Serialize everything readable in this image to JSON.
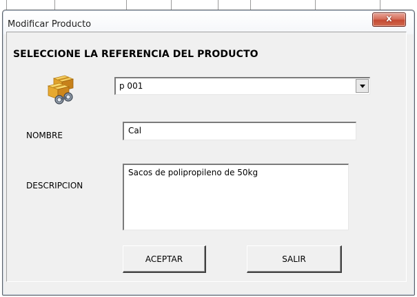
{
  "window": {
    "title": "Modificar Producto",
    "close_label": "x"
  },
  "form": {
    "heading": "SELECCIONE LA REFERENCIA DEL PRODUCTO",
    "product_icon": "boxes-binoculars-icon",
    "reference": {
      "value": "p 001",
      "dropdown_icon": "chevron-down-icon"
    },
    "nombre": {
      "label": "NOMBRE",
      "value": "Cal"
    },
    "descripcion": {
      "label": "DESCRIPCION",
      "value": "Sacos de polipropileno de 50kg"
    },
    "buttons": {
      "accept": "ACEPTAR",
      "exit": "SALIR"
    }
  },
  "colors": {
    "close_button": "#c54a33",
    "dialog_background": "#f0f0f0"
  }
}
